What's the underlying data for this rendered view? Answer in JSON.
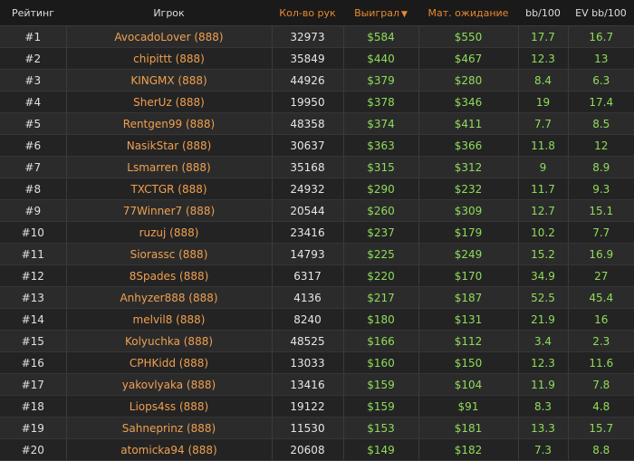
{
  "colors": {
    "background": "#222222",
    "header_text": "#dddddd",
    "header_accent": "#e8892f",
    "player_text": "#f0a050",
    "value_text": "#8fdc5a"
  },
  "table": {
    "headers": {
      "rank": "Рейтинг",
      "player": "Игрок",
      "hands": "Кол-во рук",
      "won": "Выиграл",
      "sort_icon": "caret-down-icon",
      "ev": "Мат. ожидание",
      "bb100": "bb/100",
      "evbb100": "EV bb/100"
    },
    "rows": [
      {
        "rank": "#1",
        "player": "AvocadoLover (888)",
        "hands": "32973",
        "won": "$584",
        "ev": "$550",
        "bb100": "17.7",
        "evbb100": "16.7"
      },
      {
        "rank": "#2",
        "player": "chipittt (888)",
        "hands": "35849",
        "won": "$440",
        "ev": "$467",
        "bb100": "12.3",
        "evbb100": "13"
      },
      {
        "rank": "#3",
        "player": "KINGMX (888)",
        "hands": "44926",
        "won": "$379",
        "ev": "$280",
        "bb100": "8.4",
        "evbb100": "6.3"
      },
      {
        "rank": "#4",
        "player": "SherUz (888)",
        "hands": "19950",
        "won": "$378",
        "ev": "$346",
        "bb100": "19",
        "evbb100": "17.4"
      },
      {
        "rank": "#5",
        "player": "Rentgen99 (888)",
        "hands": "48358",
        "won": "$374",
        "ev": "$411",
        "bb100": "7.7",
        "evbb100": "8.5"
      },
      {
        "rank": "#6",
        "player": "NasikStar (888)",
        "hands": "30637",
        "won": "$363",
        "ev": "$366",
        "bb100": "11.8",
        "evbb100": "12"
      },
      {
        "rank": "#7",
        "player": "Lsmarren (888)",
        "hands": "35168",
        "won": "$315",
        "ev": "$312",
        "bb100": "9",
        "evbb100": "8.9"
      },
      {
        "rank": "#8",
        "player": "TXCTGR (888)",
        "hands": "24932",
        "won": "$290",
        "ev": "$232",
        "bb100": "11.7",
        "evbb100": "9.3"
      },
      {
        "rank": "#9",
        "player": "77Winner7 (888)",
        "hands": "20544",
        "won": "$260",
        "ev": "$309",
        "bb100": "12.7",
        "evbb100": "15.1"
      },
      {
        "rank": "#10",
        "player": "ruzuj (888)",
        "hands": "23416",
        "won": "$237",
        "ev": "$179",
        "bb100": "10.2",
        "evbb100": "7.7"
      },
      {
        "rank": "#11",
        "player": "Siorassc (888)",
        "hands": "14793",
        "won": "$225",
        "ev": "$249",
        "bb100": "15.2",
        "evbb100": "16.9"
      },
      {
        "rank": "#12",
        "player": "8Spades (888)",
        "hands": "6317",
        "won": "$220",
        "ev": "$170",
        "bb100": "34.9",
        "evbb100": "27"
      },
      {
        "rank": "#13",
        "player": "Anhyzer888 (888)",
        "hands": "4136",
        "won": "$217",
        "ev": "$187",
        "bb100": "52.5",
        "evbb100": "45.4"
      },
      {
        "rank": "#14",
        "player": "melvil8 (888)",
        "hands": "8240",
        "won": "$180",
        "ev": "$131",
        "bb100": "21.9",
        "evbb100": "16"
      },
      {
        "rank": "#15",
        "player": "Kolyuchka (888)",
        "hands": "48525",
        "won": "$166",
        "ev": "$112",
        "bb100": "3.4",
        "evbb100": "2.3"
      },
      {
        "rank": "#16",
        "player": "CPHKidd (888)",
        "hands": "13033",
        "won": "$160",
        "ev": "$150",
        "bb100": "12.3",
        "evbb100": "11.6"
      },
      {
        "rank": "#17",
        "player": "yakovlyaka (888)",
        "hands": "13416",
        "won": "$159",
        "ev": "$104",
        "bb100": "11.9",
        "evbb100": "7.8"
      },
      {
        "rank": "#18",
        "player": "Liops4ss (888)",
        "hands": "19122",
        "won": "$159",
        "ev": "$91",
        "bb100": "8.3",
        "evbb100": "4.8"
      },
      {
        "rank": "#19",
        "player": "Sahneprinz (888)",
        "hands": "11530",
        "won": "$153",
        "ev": "$181",
        "bb100": "13.3",
        "evbb100": "15.7"
      },
      {
        "rank": "#20",
        "player": "atomicka94 (888)",
        "hands": "20608",
        "won": "$149",
        "ev": "$182",
        "bb100": "7.3",
        "evbb100": "8.8"
      }
    ]
  }
}
